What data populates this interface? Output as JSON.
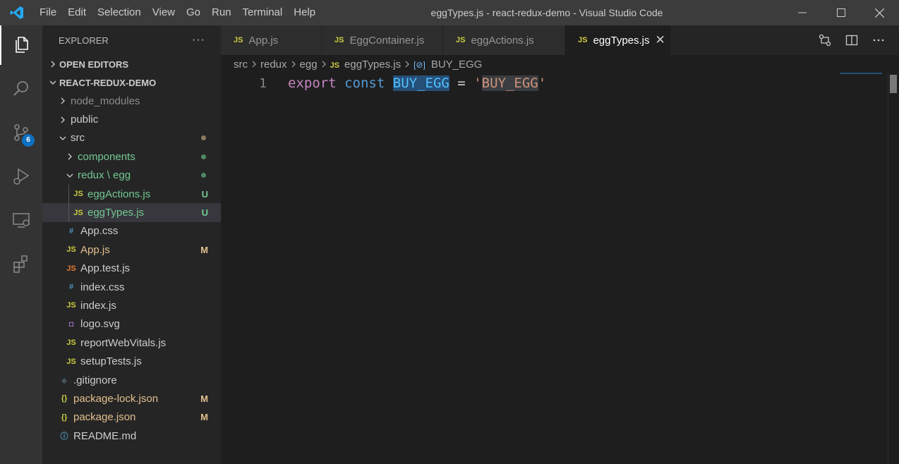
{
  "titlebar": {
    "menu": [
      "File",
      "Edit",
      "Selection",
      "View",
      "Go",
      "Run",
      "Terminal",
      "Help"
    ],
    "title": "eggTypes.js - react-redux-demo - Visual Studio Code"
  },
  "activitybar": {
    "items": [
      "explorer-icon",
      "search-icon",
      "source-control-icon",
      "run-debug-icon",
      "remote-explorer-icon",
      "extensions-icon"
    ],
    "scm_badge": "6"
  },
  "sidebar": {
    "title": "EXPLORER",
    "more": "···",
    "open_editors": "OPEN EDITORS",
    "project": "REACT-REDUX-DEMO",
    "tree": [
      {
        "label": "node_modules",
        "type": "folder",
        "icon": "",
        "color": "#8c8c8c"
      },
      {
        "label": "public",
        "type": "folder",
        "icon": "",
        "color": "#cccccc"
      },
      {
        "label": "src",
        "type": "folder-open",
        "icon": "",
        "color": "#cccccc"
      },
      {
        "label": "components",
        "type": "folder",
        "icon": "",
        "color": "#73c991"
      },
      {
        "label": "redux \\ egg",
        "type": "folder-open",
        "icon": "",
        "color": "#73c991"
      },
      {
        "label": "eggActions.js",
        "type": "file",
        "icon": "JS",
        "color": "#73c991",
        "status": "U"
      },
      {
        "label": "eggTypes.js",
        "type": "file",
        "icon": "JS",
        "color": "#73c991",
        "status": "U"
      },
      {
        "label": "App.css",
        "type": "file",
        "icon": "#",
        "color": "#cccccc"
      },
      {
        "label": "App.js",
        "type": "file",
        "icon": "JS",
        "color": "#e2c08d",
        "status": "M"
      },
      {
        "label": "App.test.js",
        "type": "file",
        "icon": "JS",
        "color": "#cccccc"
      },
      {
        "label": "index.css",
        "type": "file",
        "icon": "#",
        "color": "#cccccc"
      },
      {
        "label": "index.js",
        "type": "file",
        "icon": "JS",
        "color": "#cccccc"
      },
      {
        "label": "logo.svg",
        "type": "file",
        "icon": "svg",
        "color": "#cccccc"
      },
      {
        "label": "reportWebVitals.js",
        "type": "file",
        "icon": "JS",
        "color": "#cccccc"
      },
      {
        "label": "setupTests.js",
        "type": "file",
        "icon": "JS",
        "color": "#cccccc"
      },
      {
        "label": ".gitignore",
        "type": "file",
        "icon": "git",
        "color": "#cccccc"
      },
      {
        "label": "package-lock.json",
        "type": "file",
        "icon": "{}",
        "color": "#e2c08d",
        "status": "M"
      },
      {
        "label": "package.json",
        "type": "file",
        "icon": "{}",
        "color": "#e2c08d",
        "status": "M"
      },
      {
        "label": "README.md",
        "type": "file",
        "icon": "info",
        "color": "#cccccc"
      }
    ]
  },
  "tabs": [
    {
      "label": "App.js",
      "active": false
    },
    {
      "label": "EggContainer.js",
      "active": false
    },
    {
      "label": "eggActions.js",
      "active": false
    },
    {
      "label": "eggTypes.js",
      "active": true
    }
  ],
  "breadcrumb": {
    "parts": [
      "src",
      "redux",
      "egg",
      "eggTypes.js",
      "BUY_EGG"
    ]
  },
  "code": {
    "line_number": "1",
    "kw1": "export",
    "kw2": "const",
    "identifier": "BUY_EGG",
    "operator": "=",
    "quote_open": "'",
    "string": "BUY_EGG",
    "quote_close": "'"
  },
  "colors": {
    "accent": "#007acc",
    "modified": "#e2c08d",
    "untracked": "#73c991",
    "js_icon": "#cbcb41"
  }
}
